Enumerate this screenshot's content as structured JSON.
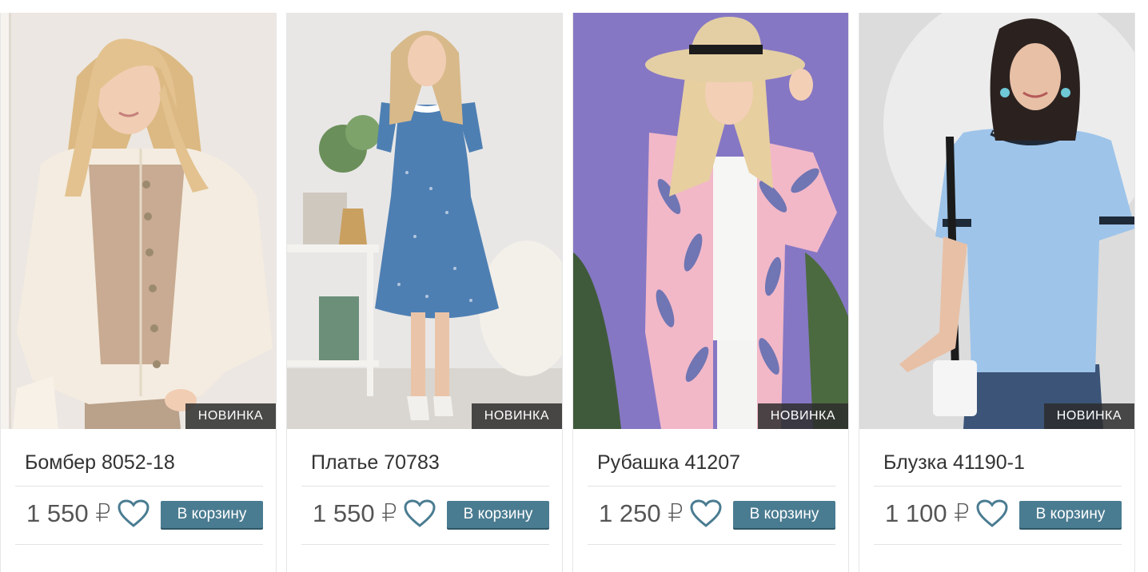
{
  "products": [
    {
      "name": "Бомбер 8052-18",
      "price": "1 550 ₽",
      "badge": "НОВИНКА",
      "cart_label": "В корзину",
      "photo_desc": "woman in cream bomber jacket",
      "colors": {
        "bg": "#ece7e2",
        "garment": "#f4ece0",
        "hair": "#e3c28f"
      }
    },
    {
      "name": "Платье 70783",
      "price": "1 550 ₽",
      "badge": "НОВИНКА",
      "cart_label": "В корзину",
      "photo_desc": "woman in blue dotted dress",
      "colors": {
        "bg": "#e8e7e6",
        "garment": "#4e7fb3",
        "hair": "#d8b98a"
      }
    },
    {
      "name": "Рубашка 41207",
      "price": "1 250 ₽",
      "badge": "НОВИНКА",
      "cart_label": "В корзину",
      "photo_desc": "woman in pink feather print shirt and straw hat",
      "colors": {
        "bg": "#8677c4",
        "garment": "#f2b8c8",
        "hair": "#e7cf9f"
      }
    },
    {
      "name": "Блузка 41190-1",
      "price": "1 100 ₽",
      "badge": "НОВИНКА",
      "cart_label": "В корзину",
      "photo_desc": "woman in light blue t-shirt",
      "colors": {
        "bg": "#dcdcdc",
        "garment": "#9ec4ea",
        "hair": "#2b2220"
      }
    }
  ],
  "icons": {
    "favorite": "heart-outline-icon"
  },
  "accent_color": "#4a7c91"
}
